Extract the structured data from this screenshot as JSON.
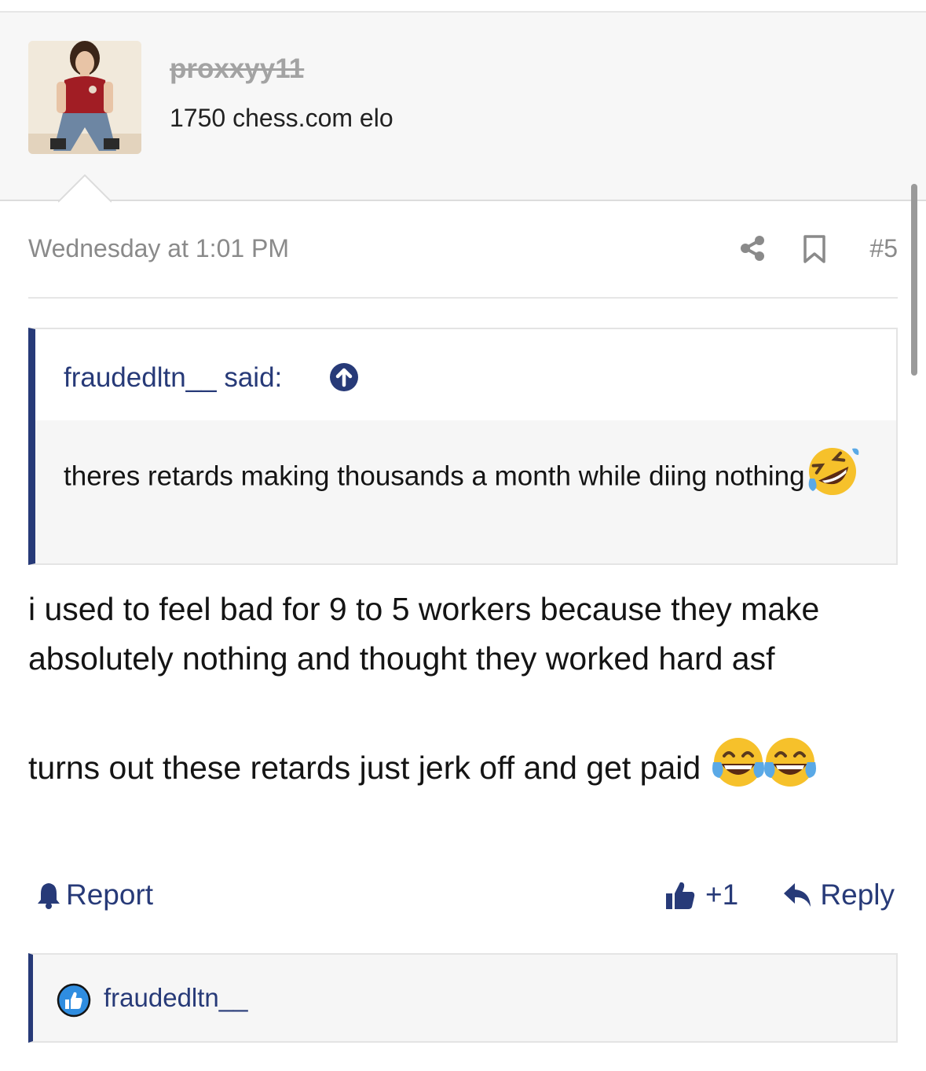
{
  "user": {
    "username": "proxxyy11",
    "title": "1750 chess.com elo"
  },
  "post": {
    "date": "Wednesday at 1:01 PM",
    "number": "#5",
    "quote": {
      "author": "fraudedltn__ said:",
      "text": "theres retards making thousands a month while diing nothing",
      "emoji": "rolling-on-floor-laughing"
    },
    "paragraphs": [
      "i used to feel bad for 9 to 5 workers because they make absolutely nothing and thought they worked hard asf",
      "turns out these retards just jerk off and get paid"
    ],
    "paragraph_emoji": [
      "face-with-tears-of-joy",
      "face-with-tears-of-joy"
    ]
  },
  "actions": {
    "report": "Report",
    "like_count": "+1",
    "reply": "Reply"
  },
  "reactions": {
    "user": "fraudedltn__",
    "icon": "like-icon"
  },
  "colors": {
    "accent": "#273a78",
    "muted": "#8a8a8a",
    "header_bg": "#f7f7f7",
    "quote_bg": "#f6f6f6",
    "like_blue": "#2f8de0"
  }
}
